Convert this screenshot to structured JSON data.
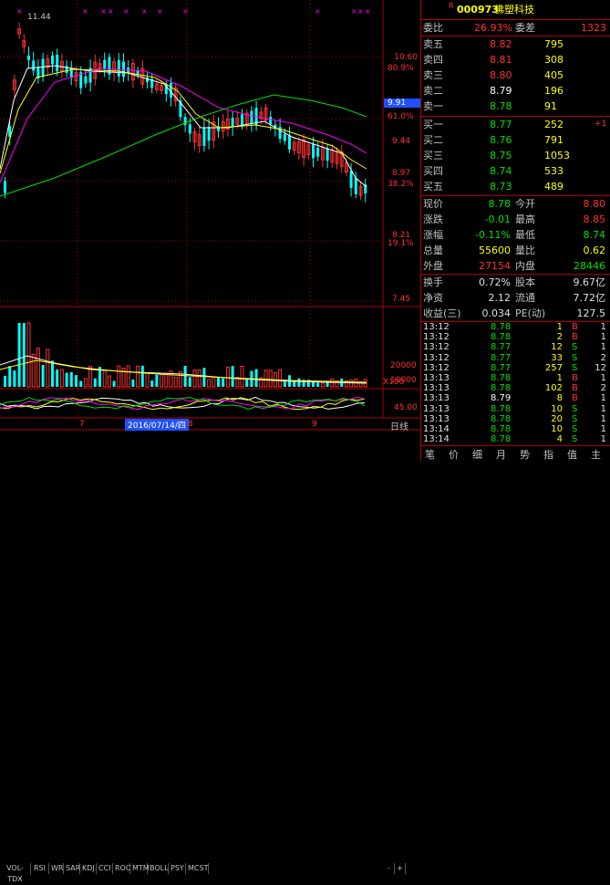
{
  "chart": {
    "price_labels": [
      "10.60",
      "9.44",
      "8.97",
      "8.21",
      "7.45"
    ],
    "pct_labels": [
      "80.9%",
      "61.0%",
      "38.2%",
      "19.1%"
    ],
    "current_price_tag": "9.91",
    "top_left_value": "11.44",
    "volume_labels": [
      "20000",
      "10000"
    ],
    "volume_unit": "X100",
    "indicator_label": "45.00",
    "date_tag": "2016/07/14/四",
    "month_labels": [
      "7",
      "8",
      "9"
    ],
    "period_label": "日线",
    "indicator_tabs": [
      "VOL-TDX",
      "RSI",
      "WR",
      "SAR",
      "KDJ",
      "CCI",
      "ROC",
      "MTM",
      "BOLL",
      "PSY",
      "MCST"
    ],
    "zoom_minus": "-",
    "zoom_plus": "+",
    "colors": {
      "up": "#ff3030",
      "down": "#00ffff",
      "ma5": "#ffffff",
      "ma10": "#ffff00",
      "ma20": "#ff00ff",
      "ma60": "#00e000",
      "grid": "#b00000"
    }
  },
  "quote": {
    "code": "000973",
    "name": "佛塑科技",
    "superscript": "R",
    "weibi_label": "委比",
    "weibi_value": "26.93%",
    "weicha_label": "委差",
    "weicha_value": "1323",
    "sell": [
      {
        "label": "卖五",
        "price": "8.82",
        "vol": "795"
      },
      {
        "label": "卖四",
        "price": "8.81",
        "vol": "308"
      },
      {
        "label": "卖三",
        "price": "8.80",
        "vol": "405"
      },
      {
        "label": "卖二",
        "price": "8.79",
        "vol": "196"
      },
      {
        "label": "卖一",
        "price": "8.78",
        "vol": "91"
      }
    ],
    "buy": [
      {
        "label": "买一",
        "price": "8.77",
        "vol": "252",
        "change": "+1"
      },
      {
        "label": "买二",
        "price": "8.76",
        "vol": "791",
        "change": ""
      },
      {
        "label": "买三",
        "price": "8.75",
        "vol": "1053",
        "change": ""
      },
      {
        "label": "买四",
        "price": "8.74",
        "vol": "533",
        "change": ""
      },
      {
        "label": "买五",
        "price": "8.73",
        "vol": "489",
        "change": ""
      }
    ],
    "stats": [
      {
        "l1": "现价",
        "v1": "8.78",
        "l2": "今开",
        "v2": "8.80"
      },
      {
        "l1": "涨跌",
        "v1": "-0.01",
        "l2": "最高",
        "v2": "8.85"
      },
      {
        "l1": "涨幅",
        "v1": "-0.11%",
        "l2": "最低",
        "v2": "8.74"
      },
      {
        "l1": "总量",
        "v1": "55600",
        "l2": "量比",
        "v2": "0.62"
      },
      {
        "l1": "外盘",
        "v1": "27154",
        "l2": "内盘",
        "v2": "28446"
      }
    ],
    "stats2": [
      {
        "l1": "换手",
        "v1": "0.72%",
        "l2": "股本",
        "v2": "9.67亿"
      },
      {
        "l1": "净资",
        "v1": "2.12",
        "l2": "流通",
        "v2": "7.72亿"
      },
      {
        "l1": "收益(三)",
        "v1": "0.034",
        "l2": "PE(动)",
        "v2": "127.5"
      }
    ],
    "ticks": [
      {
        "time": "13:12",
        "price": "8.78",
        "vol": "1",
        "bs": "B",
        "n": "1"
      },
      {
        "time": "13:12",
        "price": "8.78",
        "vol": "2",
        "bs": "B",
        "n": "1"
      },
      {
        "time": "13:12",
        "price": "8.77",
        "vol": "12",
        "bs": "S",
        "n": "1"
      },
      {
        "time": "13:12",
        "price": "8.77",
        "vol": "33",
        "bs": "S",
        "n": "2"
      },
      {
        "time": "13:12",
        "price": "8.77",
        "vol": "257",
        "bs": "S",
        "n": "12"
      },
      {
        "time": "13:13",
        "price": "8.78",
        "vol": "1",
        "bs": "B",
        "n": "1"
      },
      {
        "time": "13:13",
        "price": "8.78",
        "vol": "102",
        "bs": "B",
        "n": "2"
      },
      {
        "time": "13:13",
        "price": "8.79",
        "vol": "8",
        "bs": "B",
        "n": "1"
      },
      {
        "time": "13:13",
        "price": "8.78",
        "vol": "10",
        "bs": "S",
        "n": "1"
      },
      {
        "time": "13:13",
        "price": "8.78",
        "vol": "20",
        "bs": "S",
        "n": "1"
      },
      {
        "time": "13:14",
        "price": "8.78",
        "vol": "10",
        "bs": "S",
        "n": "1"
      },
      {
        "time": "13:14",
        "price": "8.78",
        "vol": "4",
        "bs": "S",
        "n": "1"
      }
    ],
    "bottom_tabs": [
      "笔",
      "价",
      "细",
      "月",
      "势",
      "指",
      "值",
      "主"
    ]
  }
}
